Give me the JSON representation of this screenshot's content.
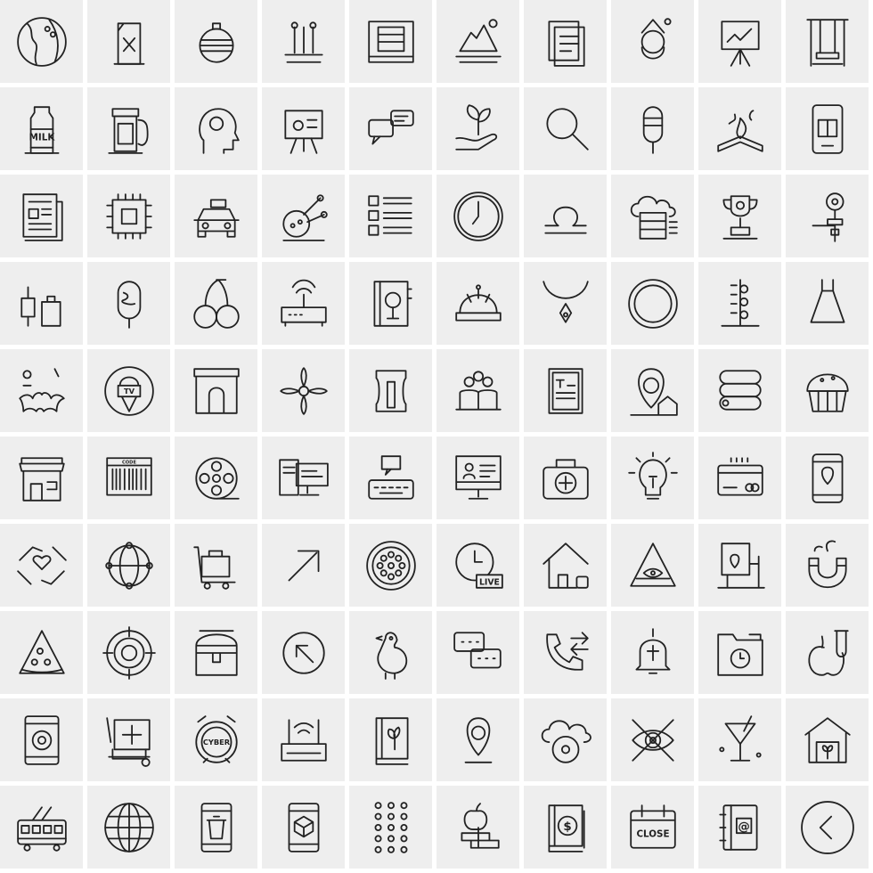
{
  "colors": {
    "tile": "#eeeeee",
    "gap": "#ffffff",
    "stroke": "#222222"
  },
  "icons": [
    {
      "name": "globe"
    },
    {
      "name": "fuel-can"
    },
    {
      "name": "christmas-ornament"
    },
    {
      "name": "test-tubes"
    },
    {
      "name": "server-drawer"
    },
    {
      "name": "iceberg"
    },
    {
      "name": "documents"
    },
    {
      "name": "santa"
    },
    {
      "name": "presentation-board"
    },
    {
      "name": "swing"
    },
    {
      "name": "milk-bottle",
      "label": "MILK"
    },
    {
      "name": "fuel-pump"
    },
    {
      "name": "head-gear"
    },
    {
      "name": "presentation-easel"
    },
    {
      "name": "chat-bubbles"
    },
    {
      "name": "plant-hand"
    },
    {
      "name": "magnifier"
    },
    {
      "name": "popsicle"
    },
    {
      "name": "book-fire"
    },
    {
      "name": "mobile-book"
    },
    {
      "name": "newspaper"
    },
    {
      "name": "cpu-chip"
    },
    {
      "name": "taxi"
    },
    {
      "name": "molecule"
    },
    {
      "name": "checklist"
    },
    {
      "name": "clock"
    },
    {
      "name": "libra"
    },
    {
      "name": "cloud-server"
    },
    {
      "name": "trophy"
    },
    {
      "name": "valve"
    },
    {
      "name": "kitchen-tools"
    },
    {
      "name": "ice-cream-bar"
    },
    {
      "name": "cherries"
    },
    {
      "name": "router"
    },
    {
      "name": "notebook-tree"
    },
    {
      "name": "helmet"
    },
    {
      "name": "pendant-necklace"
    },
    {
      "name": "plate"
    },
    {
      "name": "measuring-stick"
    },
    {
      "name": "dress"
    },
    {
      "name": "bat"
    },
    {
      "name": "tv-microphone",
      "label": "TV"
    },
    {
      "name": "storefront-arch"
    },
    {
      "name": "flower"
    },
    {
      "name": "sharpener"
    },
    {
      "name": "team"
    },
    {
      "name": "text-document"
    },
    {
      "name": "location-house"
    },
    {
      "name": "sleeping-bag"
    },
    {
      "name": "cupcake"
    },
    {
      "name": "shop"
    },
    {
      "name": "barcode",
      "label": "CODE"
    },
    {
      "name": "film-reel"
    },
    {
      "name": "computer-setup"
    },
    {
      "name": "keyboard-chat"
    },
    {
      "name": "monitor-profile"
    },
    {
      "name": "first-aid-kit"
    },
    {
      "name": "light-bulb"
    },
    {
      "name": "credit-card"
    },
    {
      "name": "mobile-location"
    },
    {
      "name": "hands-heart"
    },
    {
      "name": "globe-network"
    },
    {
      "name": "luggage-cart"
    },
    {
      "name": "arrow-up-right"
    },
    {
      "name": "pizza-base"
    },
    {
      "name": "clock-live",
      "label": "LIVE"
    },
    {
      "name": "house-lock"
    },
    {
      "name": "pyramid-eye"
    },
    {
      "name": "building-map"
    },
    {
      "name": "magnet"
    },
    {
      "name": "pizza-slice"
    },
    {
      "name": "target"
    },
    {
      "name": "treasure-chest"
    },
    {
      "name": "arrow-circle-up-left"
    },
    {
      "name": "chicken"
    },
    {
      "name": "chat"
    },
    {
      "name": "phone-transfer"
    },
    {
      "name": "bell"
    },
    {
      "name": "folder-time"
    },
    {
      "name": "apple-test-tube"
    },
    {
      "name": "mobile-speaker"
    },
    {
      "name": "tablet-drawing"
    },
    {
      "name": "alarm-clock",
      "label": "CYBER"
    },
    {
      "name": "wifi-router"
    },
    {
      "name": "book-plant"
    },
    {
      "name": "map-pin"
    },
    {
      "name": "cloud-disk"
    },
    {
      "name": "eye-pencils"
    },
    {
      "name": "cocktail"
    },
    {
      "name": "greenhouse"
    },
    {
      "name": "trolleybus"
    },
    {
      "name": "globe-grid"
    },
    {
      "name": "mobile-trash"
    },
    {
      "name": "mobile-box"
    },
    {
      "name": "dot-grid"
    },
    {
      "name": "apple-books"
    },
    {
      "name": "book-dollar",
      "label": "$"
    },
    {
      "name": "calendar-close",
      "label": "CLOSE"
    },
    {
      "name": "address-book",
      "label": "@"
    },
    {
      "name": "chevron-left-circle"
    }
  ]
}
